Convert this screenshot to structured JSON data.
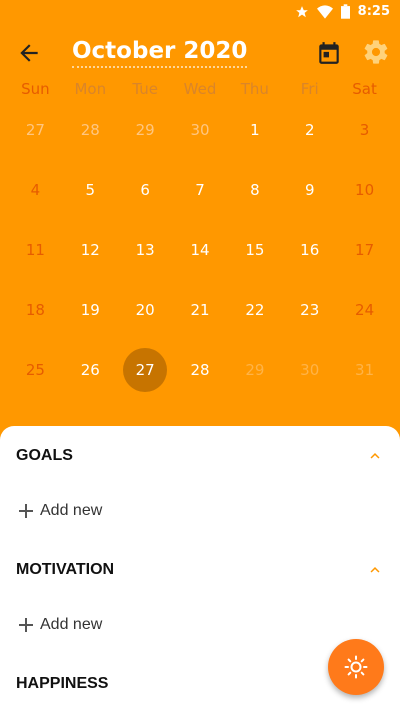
{
  "status": {
    "time": "8:25"
  },
  "header": {
    "title": "October 2020"
  },
  "weekdays": [
    "Sun",
    "Mon",
    "Tue",
    "Wed",
    "Thu",
    "Fri",
    "Sat"
  ],
  "calendar": {
    "rows": [
      [
        "27",
        "28",
        "29",
        "30",
        "1",
        "2",
        "3"
      ],
      [
        "4",
        "5",
        "6",
        "7",
        "8",
        "9",
        "10"
      ],
      [
        "11",
        "12",
        "13",
        "14",
        "15",
        "16",
        "17"
      ],
      [
        "18",
        "19",
        "20",
        "21",
        "22",
        "23",
        "24"
      ],
      [
        "25",
        "26",
        "27",
        "28",
        "29",
        "30",
        "31"
      ]
    ],
    "selected": "27"
  },
  "sections": [
    {
      "title": "GOALS",
      "add_label": "Add new"
    },
    {
      "title": "MOTIVATION",
      "add_label": "Add new"
    },
    {
      "title": "HAPPINESS"
    }
  ],
  "colors": {
    "primary": "#ff9800",
    "weekend": "#e65c00",
    "selected": "#c77400",
    "fab": "#ff7a1a"
  }
}
